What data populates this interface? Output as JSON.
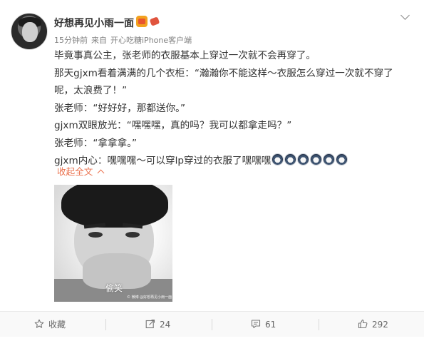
{
  "post": {
    "username": "好想再见小雨一面",
    "time": "15分钟前",
    "source_prefix": "来自",
    "source": "开心吃糖iPhone客户端",
    "lines": [
      "毕竟事真公主，张老师的衣服基本上穿过一次就不会再穿了。",
      "那天gjxm看着满满的几个衣柜：“瀚瀚你不能这样～衣服怎么穿过一次就不穿了呢，太浪费了！”",
      "张老师：“好好好，那都送你。”",
      "gjxm双眼放光：“嘿嘿嘿，真的吗？我可以都拿走吗？”",
      "张老师：“拿拿拿。”",
      "gjxm内心：嘿嘿嘿～可以穿lp穿过的衣服了嘿嘿嘿"
    ],
    "collapse_label": "收起全文",
    "photo_caption": "偷笑",
    "photo_watermark": "© 微博  @好想再见小雨一面"
  },
  "actions": {
    "favorite_label": "收藏",
    "forward_count": "24",
    "comment_count": "61",
    "like_count": "292"
  },
  "colors": {
    "link_orange": "#eb7350",
    "text": "#333333",
    "meta": "#808080"
  }
}
